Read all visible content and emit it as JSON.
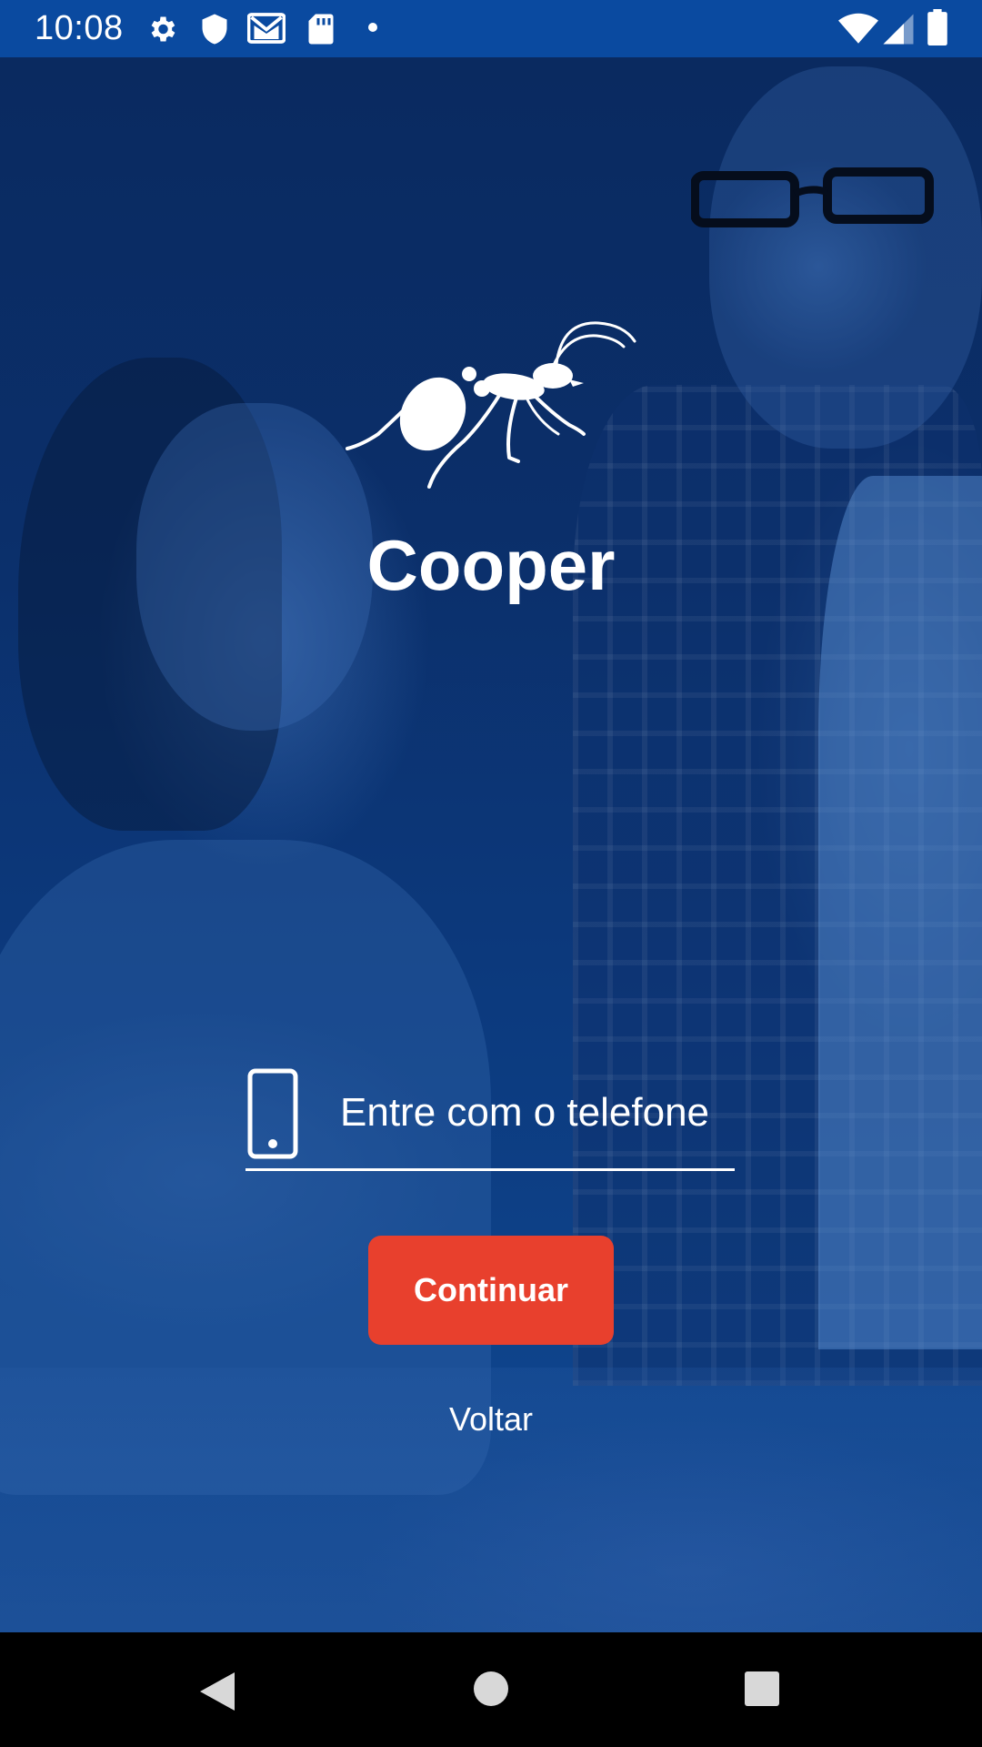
{
  "status_bar": {
    "time": "10:08",
    "left_icons": [
      "gear-icon",
      "shield-icon",
      "gmail-icon",
      "sd-card-icon",
      "dot-icon"
    ],
    "right_icons": [
      "wifi-icon",
      "cell-signal-icon",
      "battery-icon"
    ],
    "background_color": "#0a4aa0"
  },
  "branding": {
    "logo": "ant-icon",
    "app_name": "Cooper"
  },
  "login": {
    "phone_placeholder": "Entre com o telefone",
    "phone_value": "",
    "phone_icon": "smartphone-icon",
    "continue_label": "Continuar",
    "back_label": "Voltar",
    "accent_color": "#e8402d"
  },
  "nav_bar": {
    "buttons": [
      "back-triangle-icon",
      "home-circle-icon",
      "recents-square-icon"
    ]
  }
}
